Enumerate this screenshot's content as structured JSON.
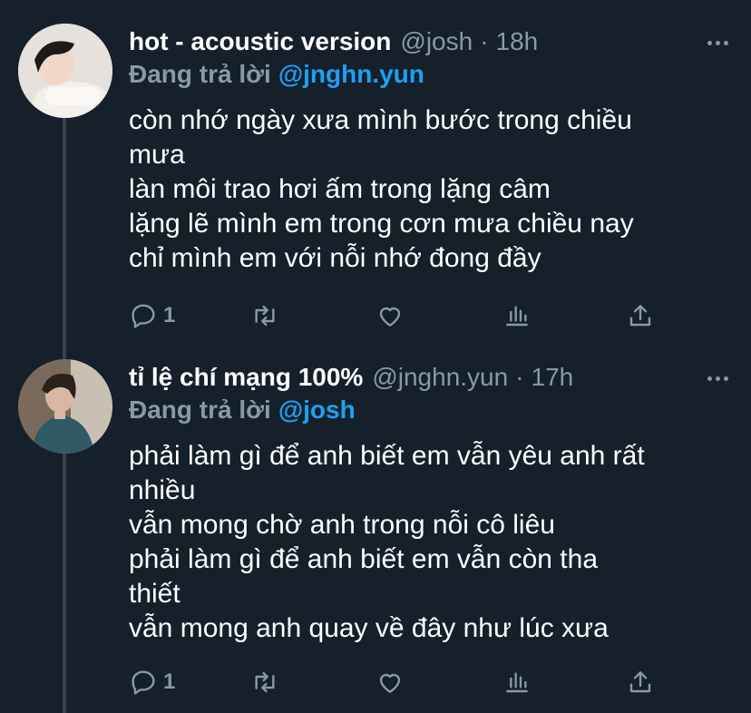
{
  "tweets": [
    {
      "name": "hot - acoustic version",
      "handle": "@josh",
      "separator": "·",
      "time": "18h",
      "reply_prefix": "Đang trả lời",
      "reply_mention": "@jnghn.yun",
      "lines": [
        "còn nhớ ngày xưa mình bước trong chiều",
        "mưa",
        "làn môi trao hơi ấm trong lặng câm",
        "lặng lẽ mình em trong cơn mưa chiều nay",
        "chỉ mình em với nỗi nhớ đong đầy"
      ],
      "reply_count": "1",
      "icons": [
        "reply-icon",
        "retweet-icon",
        "like-icon",
        "stats-icon",
        "share-icon"
      ]
    },
    {
      "name": "tỉ lệ chí mạng 100%",
      "handle": "@jnghn.yun",
      "separator": "·",
      "time": "17h",
      "reply_prefix": "Đang trả lời",
      "reply_mention": "@josh",
      "lines": [
        "phải làm gì để anh biết em vẫn yêu anh rất",
        "nhiều",
        "vẫn mong chờ anh trong nỗi cô liêu",
        "phải làm gì để anh biết em vẫn còn tha",
        "thiết",
        "vẫn mong anh quay về đây như lúc xưa"
      ],
      "reply_count": "1",
      "icons": [
        "reply-icon",
        "retweet-icon",
        "like-icon",
        "stats-icon",
        "share-icon"
      ]
    }
  ],
  "colors": {
    "background": "#15202b",
    "secondary_text": "#8899a6",
    "mention": "#1da1f2",
    "thread_line": "#38444d"
  }
}
